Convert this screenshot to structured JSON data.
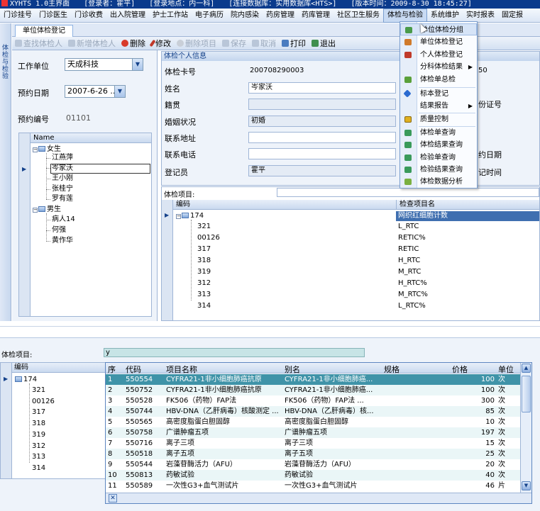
{
  "titlebar": {
    "app": "XYHTS 1.0主界面",
    "user": "[登录者：霍平]",
    "location": "[登录地点：内一科]",
    "database": "[连接数据库：实用数据库<HTS>]",
    "time": "[版本时间：2009-8-30 18:45:27]"
  },
  "menubar": [
    "门诊挂号",
    "门诊医生",
    "门诊收费",
    "出入院管理",
    "护士工作站",
    "电子病历",
    "院内感染",
    "药房管理",
    "药库管理",
    "社区卫生服务",
    "体检与检验",
    "系统维护",
    "实时报表",
    "固定报"
  ],
  "leftstrip": "体检与检验",
  "tab": "单位体检登记",
  "toolbar": {
    "query": "查找体检人",
    "add": "新增体检人",
    "delete": "删除",
    "edit": "修改",
    "delete_item": "删除项目",
    "save": "保存",
    "cancel": "取消",
    "print": "打印",
    "exit": "退出"
  },
  "leftform": {
    "work_unit_label": "工作单位",
    "work_unit_value": "天成科技",
    "appoint_date_label": "预约日期",
    "appoint_date_value": "2007-6-26 ...",
    "appoint_no_label": "预约编号",
    "appoint_no_value": "01101"
  },
  "tree": {
    "header": "Name",
    "female": "女生",
    "female_items": [
      "江燕萍",
      "岑家沃",
      "王小刚",
      "张桂宁",
      "罗有莲"
    ],
    "male": "男生",
    "male_items": [
      "病人14",
      "何强",
      "黄作华"
    ]
  },
  "info": {
    "header": "体检个人信息",
    "card_label": "体检卡号",
    "card_value": "200708290003",
    "name_label": "姓名",
    "name_value": "岑家沃",
    "native_label": "籍贯",
    "marital_label": "婚姻状况",
    "marital_value": "初婚",
    "address_label": "联系地址",
    "phone_label": "联系电话",
    "registrar_label": "登记员",
    "registrar_value": "霍平",
    "right_value": "50",
    "id_label": "份证号",
    "date_label": "约日期",
    "time_label": "记时间"
  },
  "items_label": "体检项目:",
  "items1": {
    "col_code": "编码",
    "col_name": "检查项目名",
    "root_code": "174",
    "root_name": "网织红细胞计数",
    "rows": [
      {
        "code": "321",
        "name": "L_RTC"
      },
      {
        "code": "00126",
        "name": "RETIC%"
      },
      {
        "code": "317",
        "name": "RETIC"
      },
      {
        "code": "318",
        "name": "H_RTC"
      },
      {
        "code": "319",
        "name": "M_RTC"
      },
      {
        "code": "312",
        "name": "H_RTC%"
      },
      {
        "code": "313",
        "name": "M_RTC%"
      },
      {
        "code": "314",
        "name": "L_RTC%"
      }
    ]
  },
  "menu": {
    "items": [
      "单位体检分组",
      "单位体检登记",
      "个人体检登记",
      "分科体检结果",
      "体检单总检",
      "标本登记",
      "结果报告",
      "质量控制",
      "体检单查询",
      "体检结果查询",
      "检验单查询",
      "检验结果查询",
      "体检数据分析"
    ]
  },
  "bottom": {
    "items_label": "体检项目:",
    "filter_value": "y",
    "col_code": "编码",
    "root_code": "174",
    "codes": [
      "321",
      "00126",
      "317",
      "318",
      "319",
      "312",
      "313",
      "314"
    ],
    "popup_headers": [
      "序",
      "代码",
      "项目名称",
      "别名",
      "规格",
      "价格",
      "单位"
    ],
    "popup_rows": [
      {
        "no": "1",
        "code": "550554",
        "name": "CYFRA21-1非小细胞肺癌抗原",
        "alias": "CYFRA21-1非小细胞肺癌...",
        "spec": "",
        "price": "100",
        "unit": "次"
      },
      {
        "no": "2",
        "code": "550752",
        "name": "CYFRA21-1非小细胞肺癌抗原",
        "alias": "CYFRA21-1非小细胞肺癌...",
        "spec": "",
        "price": "100",
        "unit": "次"
      },
      {
        "no": "3",
        "code": "550528",
        "name": "FK506（药物）FAP法",
        "alias": "FK506（药物）FAP法    ...",
        "spec": "",
        "price": "300",
        "unit": "次"
      },
      {
        "no": "4",
        "code": "550744",
        "name": "HBV-DNA（乙肝病毒）核酸测定 ...",
        "alias": "HBV-DNA（乙肝病毒）核...",
        "spec": "",
        "price": "85",
        "unit": "次"
      },
      {
        "no": "5",
        "code": "550565",
        "name": "高密度脂蛋白胆固醇",
        "alias": "高密度脂蛋白胆固醇",
        "spec": "",
        "price": "10",
        "unit": "次"
      },
      {
        "no": "6",
        "code": "550758",
        "name": "广谱肿瘤五项",
        "alias": "广谱肿瘤五项",
        "spec": "",
        "price": "197",
        "unit": "次"
      },
      {
        "no": "7",
        "code": "550716",
        "name": "离子三项",
        "alias": "离子三项",
        "spec": "",
        "price": "15",
        "unit": "次"
      },
      {
        "no": "8",
        "code": "550518",
        "name": "离子五项",
        "alias": "离子五项",
        "spec": "",
        "price": "25",
        "unit": "次"
      },
      {
        "no": "9",
        "code": "550544",
        "name": "岩藻苷酶活力（AFU）",
        "alias": "岩藻苷酶活力（AFU）",
        "spec": "",
        "price": "20",
        "unit": "次"
      },
      {
        "no": "10",
        "code": "550813",
        "name": "药敏试验",
        "alias": "药敏试验",
        "spec": "",
        "price": "40",
        "unit": "次"
      },
      {
        "no": "11",
        "code": "550589",
        "name": "一次性G3+血气测试片",
        "alias": "一次性G3+血气测试片",
        "spec": "",
        "price": "46",
        "unit": "片"
      }
    ],
    "close_glyph": "✕"
  }
}
